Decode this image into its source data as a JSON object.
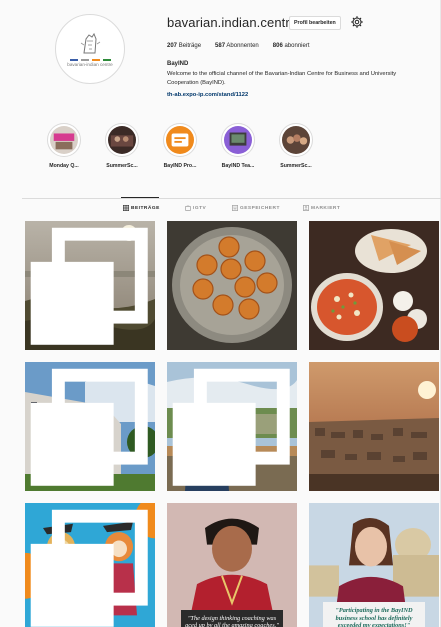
{
  "profile": {
    "username": "bavarian.indian.centre",
    "edit_button": "Profil bearbeiten",
    "avatar_text": "bavarian-indian centre",
    "stats": {
      "posts_count": "207",
      "posts_label": "Beiträge",
      "followers_count": "587",
      "followers_label": "Abonnenten",
      "following_count": "806",
      "following_label": "abonniert"
    },
    "full_name": "BayIND",
    "bio": "Welcome to the official channel of the Bavarian-Indian Centre for Business and University Cooperation (BayIND).",
    "link": "th-ab.expo-ip.com/stand/1122"
  },
  "highlights": [
    {
      "label": "Monday Q...",
      "icon": "monday-quiz-thumb"
    },
    {
      "label": "SummerSc...",
      "icon": "summer-school-thumb"
    },
    {
      "label": "BayIND Pro...",
      "icon": "bayind-program-thumb"
    },
    {
      "label": "BayIND Tea...",
      "icon": "bayind-team-thumb"
    },
    {
      "label": "SummerSc...",
      "icon": "summer-school-2-thumb"
    }
  ],
  "tabs": [
    {
      "label": "BEITRÄGE",
      "icon": "grid-icon",
      "active": true
    },
    {
      "label": "IGTV",
      "icon": "igtv-icon",
      "active": false
    },
    {
      "label": "GESPEICHERT",
      "icon": "bookmark-icon",
      "active": false
    },
    {
      "label": "MARKIERT",
      "icon": "tag-icon",
      "active": false
    }
  ],
  "posts": {
    "p7_caption": "\"The design thinking coaching was aced up by all the amazing coaches.\"",
    "p8_caption": "\"Participating in the BayIND business school has definitely exceeded my expectations!\""
  },
  "colors": {
    "accent_link": "#00376b",
    "text": "#262626",
    "muted": "#8e8e8e",
    "border": "#dbdbdb",
    "background": "#fafafa"
  }
}
